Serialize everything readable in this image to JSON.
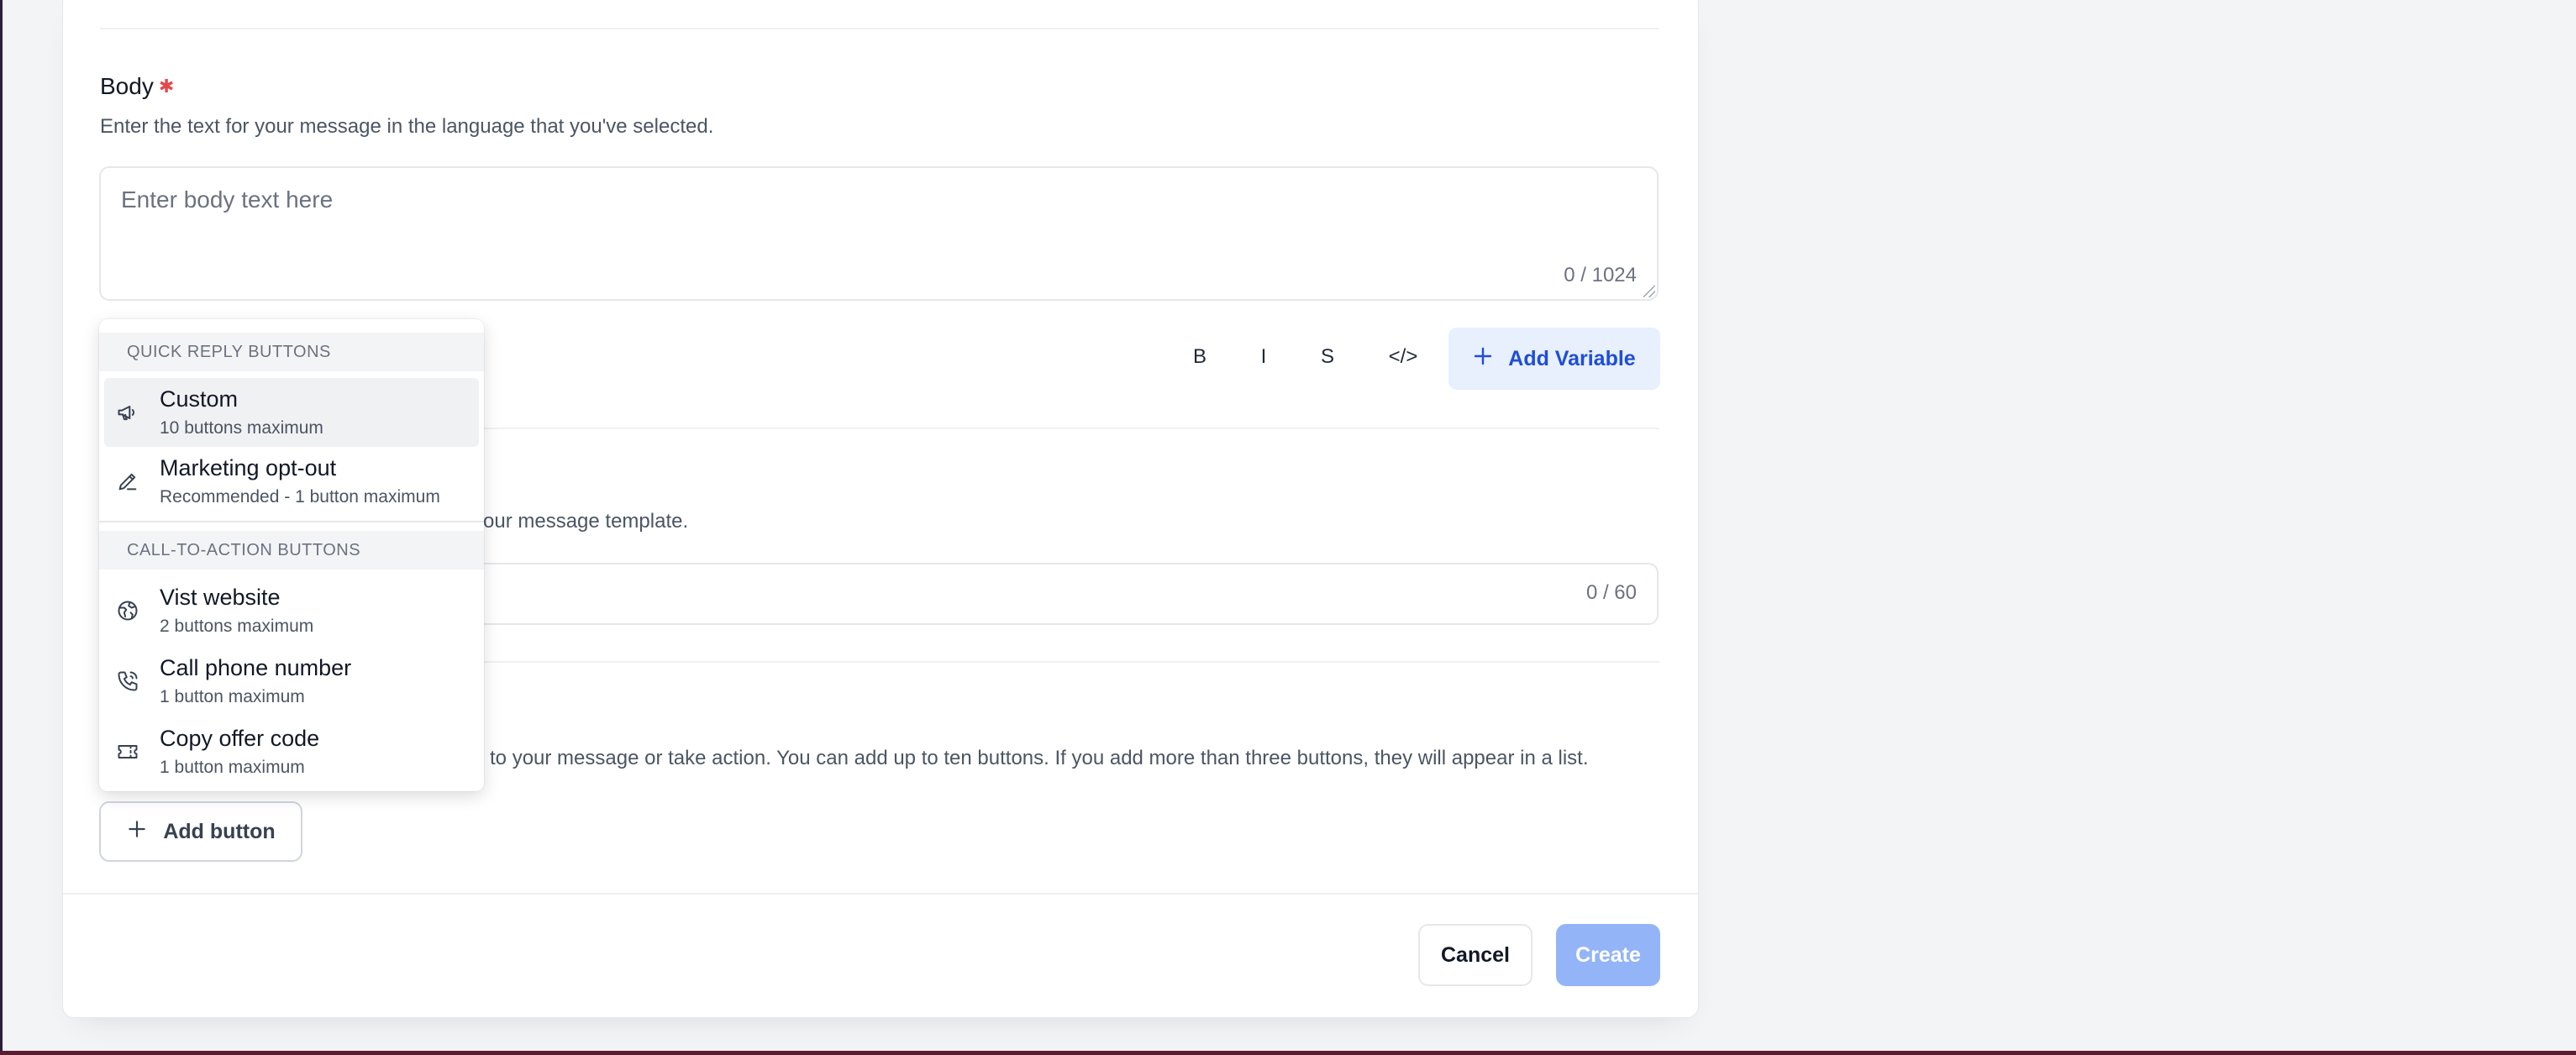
{
  "body_section": {
    "title": "Body",
    "description": "Enter the text for your message in the language that you've selected.",
    "placeholder": "Enter body text here",
    "counter": "0 / 1024"
  },
  "toolbar": {
    "bold": "B",
    "italic": "I",
    "strikethrough": "S",
    "code": "</>",
    "add_variable": "Add Variable"
  },
  "footer_section": {
    "description_partial": "your message template.",
    "counter": "0 / 60"
  },
  "buttons_section": {
    "description_partial": "d to your message or take action. You can add up to ten buttons. If you add more than three buttons, they will appear in a list.",
    "add_button": "Add button"
  },
  "dropdown": {
    "quick_reply_header": "QUICK REPLY BUTTONS",
    "quick_reply_items": [
      {
        "label": "Custom",
        "sub": "10 buttons maximum",
        "icon": "megaphone-icon"
      },
      {
        "label": "Marketing opt-out",
        "sub": "Recommended - 1 button maximum",
        "icon": "pen-icon"
      }
    ],
    "cta_header": "CALL-TO-ACTION BUTTONS",
    "cta_items": [
      {
        "label": "Vist website",
        "sub": "2 buttons maximum",
        "icon": "globe-icon"
      },
      {
        "label": "Call phone number",
        "sub": "1 button maximum",
        "icon": "phone-icon"
      },
      {
        "label": "Copy offer code",
        "sub": "1 button maximum",
        "icon": "ticket-icon"
      }
    ]
  },
  "actions": {
    "cancel": "Cancel",
    "create": "Create"
  }
}
